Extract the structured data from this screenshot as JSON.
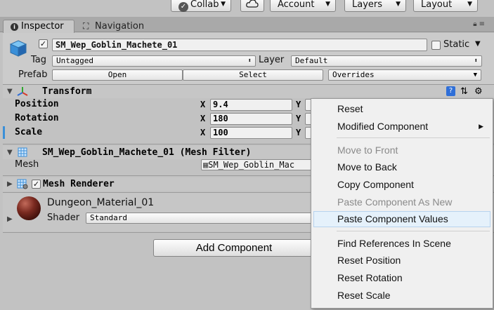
{
  "toolbar": {
    "collab": "Collab",
    "account": "Account",
    "layers": "Layers",
    "layout": "Layout"
  },
  "tabs": {
    "inspector": "Inspector",
    "navigation": "Navigation"
  },
  "header": {
    "object_name": "SM_Wep_Goblin_Machete_01",
    "static_label": "Static",
    "tag_label": "Tag",
    "tag_value": "Untagged",
    "layer_label": "Layer",
    "layer_value": "Default",
    "prefab_label": "Prefab",
    "open_label": "Open",
    "select_label": "Select",
    "overrides_label": "Overrides"
  },
  "transform": {
    "title": "Transform",
    "rows": [
      {
        "label": "Position",
        "x": "9.4",
        "y_label": "Y"
      },
      {
        "label": "Rotation",
        "x": "180",
        "y_label": "Y"
      },
      {
        "label": "Scale",
        "x": "100",
        "y_label": "Y"
      }
    ],
    "x_label": "X"
  },
  "mesh_filter": {
    "title": "SM_Wep_Goblin_Machete_01 (Mesh Filter)",
    "mesh_label": "Mesh",
    "mesh_value": "SM_Wep_Goblin_Mac"
  },
  "mesh_renderer": {
    "title": "Mesh Renderer"
  },
  "material": {
    "name": "Dungeon_Material_01",
    "shader_label": "Shader",
    "shader_value": "Standard"
  },
  "add_component_label": "Add Component",
  "context_menu": {
    "items": [
      {
        "label": "Reset",
        "state": "enabled"
      },
      {
        "label": "Modified Component",
        "state": "enabled"
      },
      {
        "label": "Move to Front",
        "state": "disabled"
      },
      {
        "label": "Move to Back",
        "state": "enabled"
      },
      {
        "label": "Copy Component",
        "state": "enabled"
      },
      {
        "label": "Paste Component As New",
        "state": "disabled"
      },
      {
        "label": "Paste Component Values",
        "state": "hover"
      },
      {
        "label": "Find References In Scene",
        "state": "enabled"
      },
      {
        "label": "Reset Position",
        "state": "enabled"
      },
      {
        "label": "Reset Rotation",
        "state": "enabled"
      },
      {
        "label": "Reset Scale",
        "state": "enabled"
      }
    ]
  },
  "colors": {
    "panel_bg": "#c2c2c2",
    "menu_bg": "#f0f0f0",
    "menu_hover": "#e5f1fb",
    "scale_marker": "#3a8fd8"
  },
  "icons": [
    "collab-check-icon",
    "cloud-icon",
    "info-icon",
    "navigation-icon",
    "lock-icon",
    "tab-menu-icon",
    "cube-icon",
    "transform-axes-icon",
    "mesh-filter-icon",
    "mesh-renderer-icon",
    "material-sphere-icon",
    "help-book-icon",
    "presets-icon",
    "gear-icon"
  ]
}
